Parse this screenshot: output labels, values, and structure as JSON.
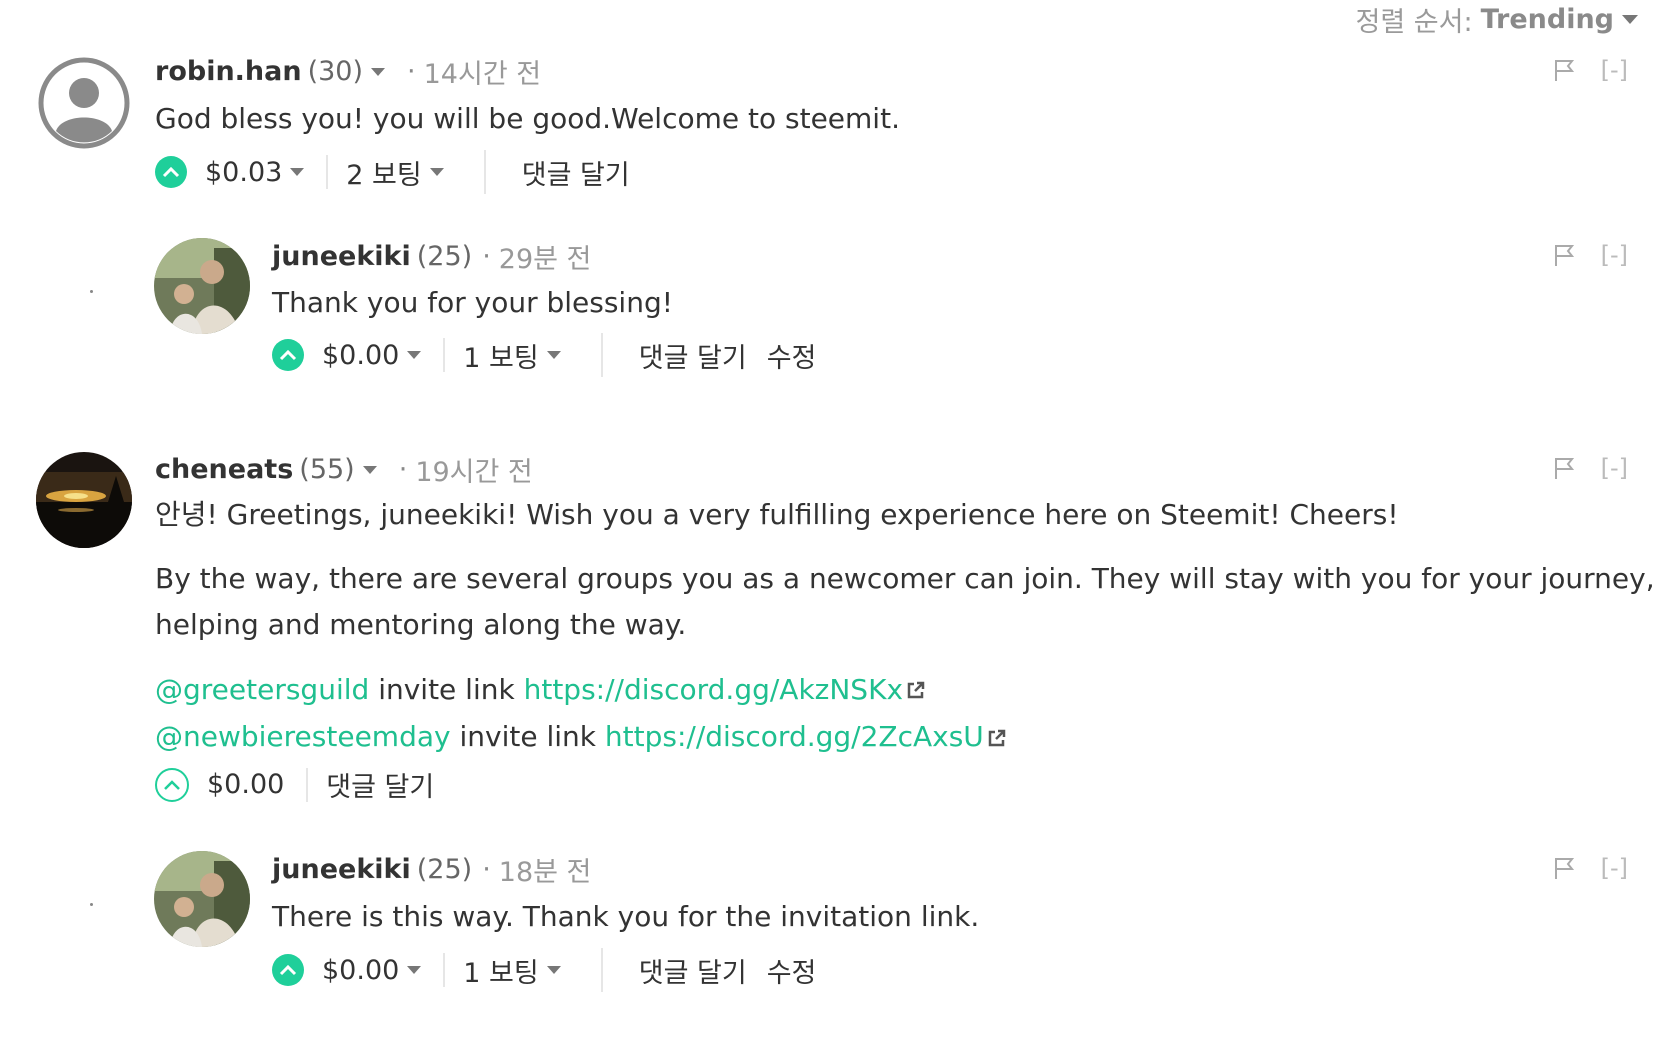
{
  "sort": {
    "label": "정렬 순서:",
    "value": "Trending"
  },
  "comments": [
    {
      "author": "robin.han",
      "rep": "(30)",
      "time": "14시간 전",
      "body": [
        "God bless you! you will be good.Welcome to steemit."
      ],
      "payout": "$0.03",
      "votes": "2 보팅",
      "reply": "댓글 달기",
      "collapse": "[-]"
    },
    {
      "author": "juneekiki",
      "rep": "(25)",
      "time": "29분 전",
      "body": [
        "Thank you for your blessing!"
      ],
      "payout": "$0.00",
      "votes": "1 보팅",
      "reply": "댓글 달기",
      "edit": "수정",
      "collapse": "[-]"
    },
    {
      "author": "cheneats",
      "rep": "(55)",
      "time": "19시간 전",
      "body": [
        "안녕! Greetings, juneekiki! Wish you a very fulfilling experience here on Steemit! Cheers!",
        "By the way, there are several groups you as a newcomer can join. They will stay with you for your journey,",
        "helping and mentoring along the way."
      ],
      "links": [
        {
          "mention": "@greetersguild",
          "text": "invite link",
          "url": "https://discord.gg/AkzNSKx"
        },
        {
          "mention": "@newbieresteemday",
          "text": "invite link",
          "url": "https://discord.gg/2ZcAxsU"
        }
      ],
      "payout": "$0.00",
      "reply": "댓글 달기",
      "collapse": "[-]"
    },
    {
      "author": "juneekiki",
      "rep": "(25)",
      "time": "18분 전",
      "body": [
        "There is this way. Thank you for the invitation link."
      ],
      "payout": "$0.00",
      "votes": "1 보팅",
      "reply": "댓글 달기",
      "edit": "수정",
      "collapse": "[-]"
    }
  ],
  "colors": {
    "accent": "#1fcf9a",
    "link": "#1fbf8f"
  }
}
